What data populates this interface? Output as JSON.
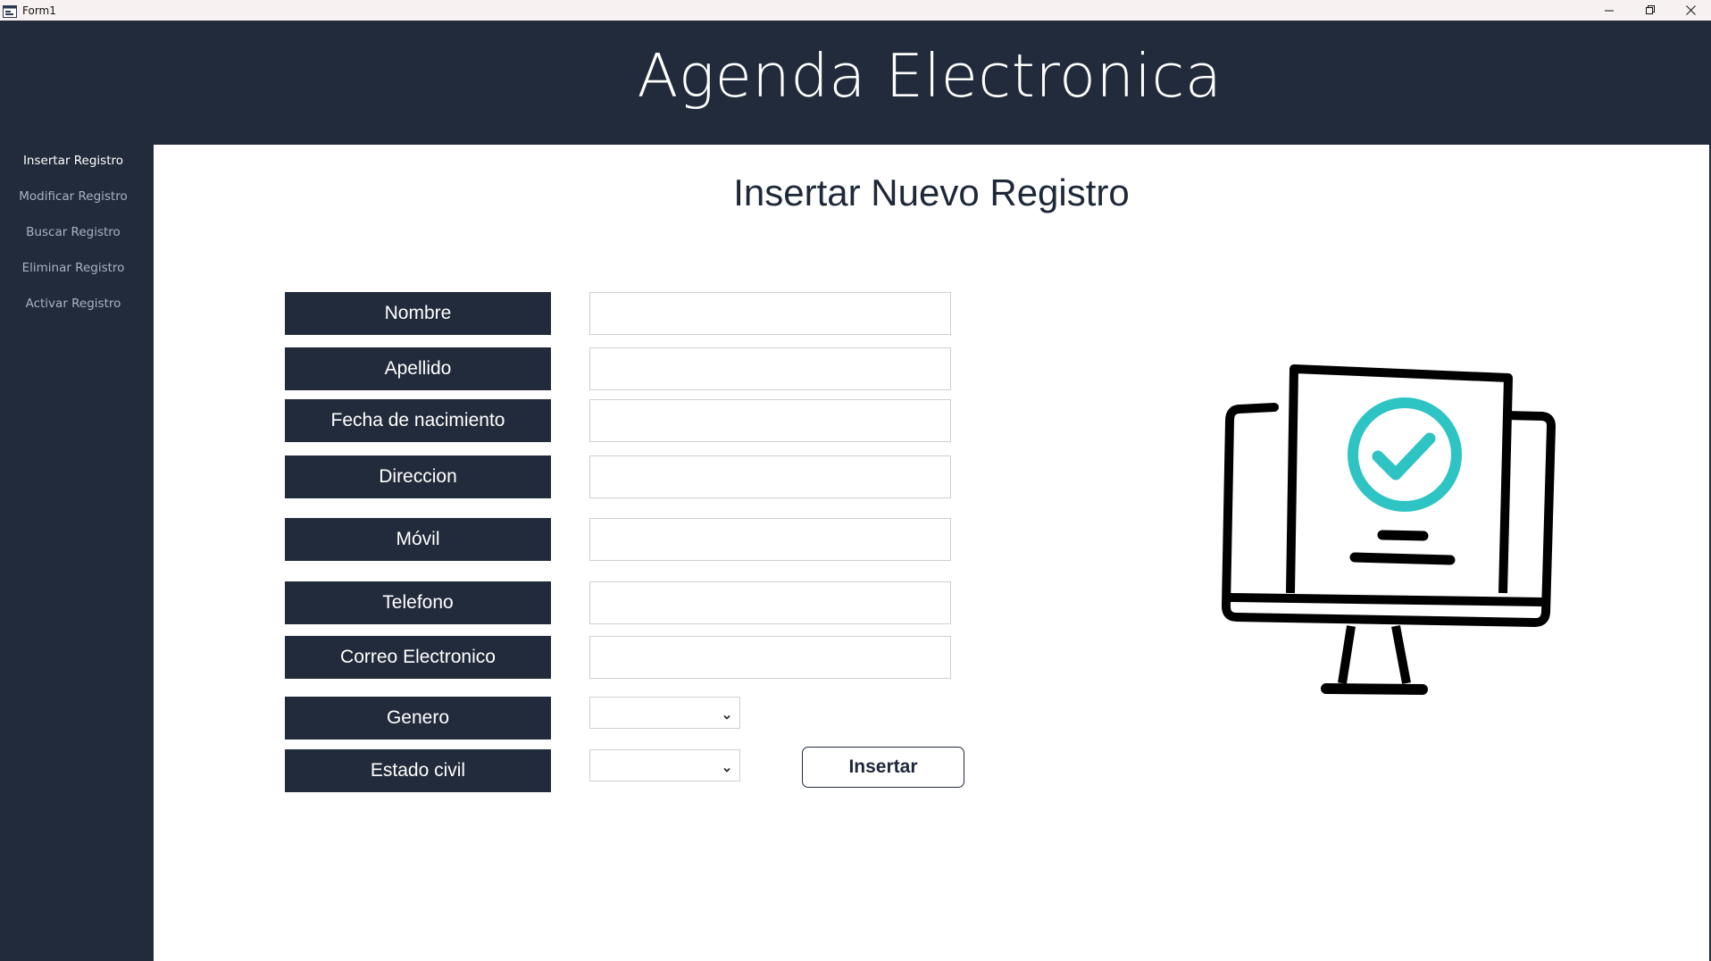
{
  "window": {
    "title": "Form1"
  },
  "header": {
    "title": "Agenda Electronica"
  },
  "sidebar": {
    "items": [
      {
        "label": "Insertar Registro",
        "active": true
      },
      {
        "label": "Modificar Registro",
        "active": false
      },
      {
        "label": "Buscar Registro",
        "active": false
      },
      {
        "label": "Eliminar Registro",
        "active": false
      },
      {
        "label": "Activar Registro",
        "active": false
      }
    ]
  },
  "main": {
    "title": "Insertar Nuevo Registro",
    "fields": {
      "nombre": {
        "label": "Nombre",
        "value": ""
      },
      "apellido": {
        "label": "Apellido",
        "value": ""
      },
      "fecha": {
        "label": "Fecha de nacimiento",
        "value": ""
      },
      "direccion": {
        "label": "Direccion",
        "value": ""
      },
      "movil": {
        "label": "Móvil",
        "value": ""
      },
      "telefono": {
        "label": "Telefono",
        "value": ""
      },
      "correo": {
        "label": "Correo Electronico",
        "value": ""
      },
      "genero": {
        "label": "Genero",
        "selected": ""
      },
      "estado": {
        "label": "Estado civil",
        "selected": ""
      }
    },
    "insert_button": "Insertar"
  },
  "icons": {
    "app": "app-window-icon",
    "minimize": "minimize-icon",
    "restore": "restore-icon",
    "close": "close-icon",
    "chevron": "chevron-down-icon",
    "illustration": "monitor-checkmark-icon"
  },
  "colors": {
    "header_bg": "#222b3b",
    "accent_check": "#2ec4c4"
  }
}
